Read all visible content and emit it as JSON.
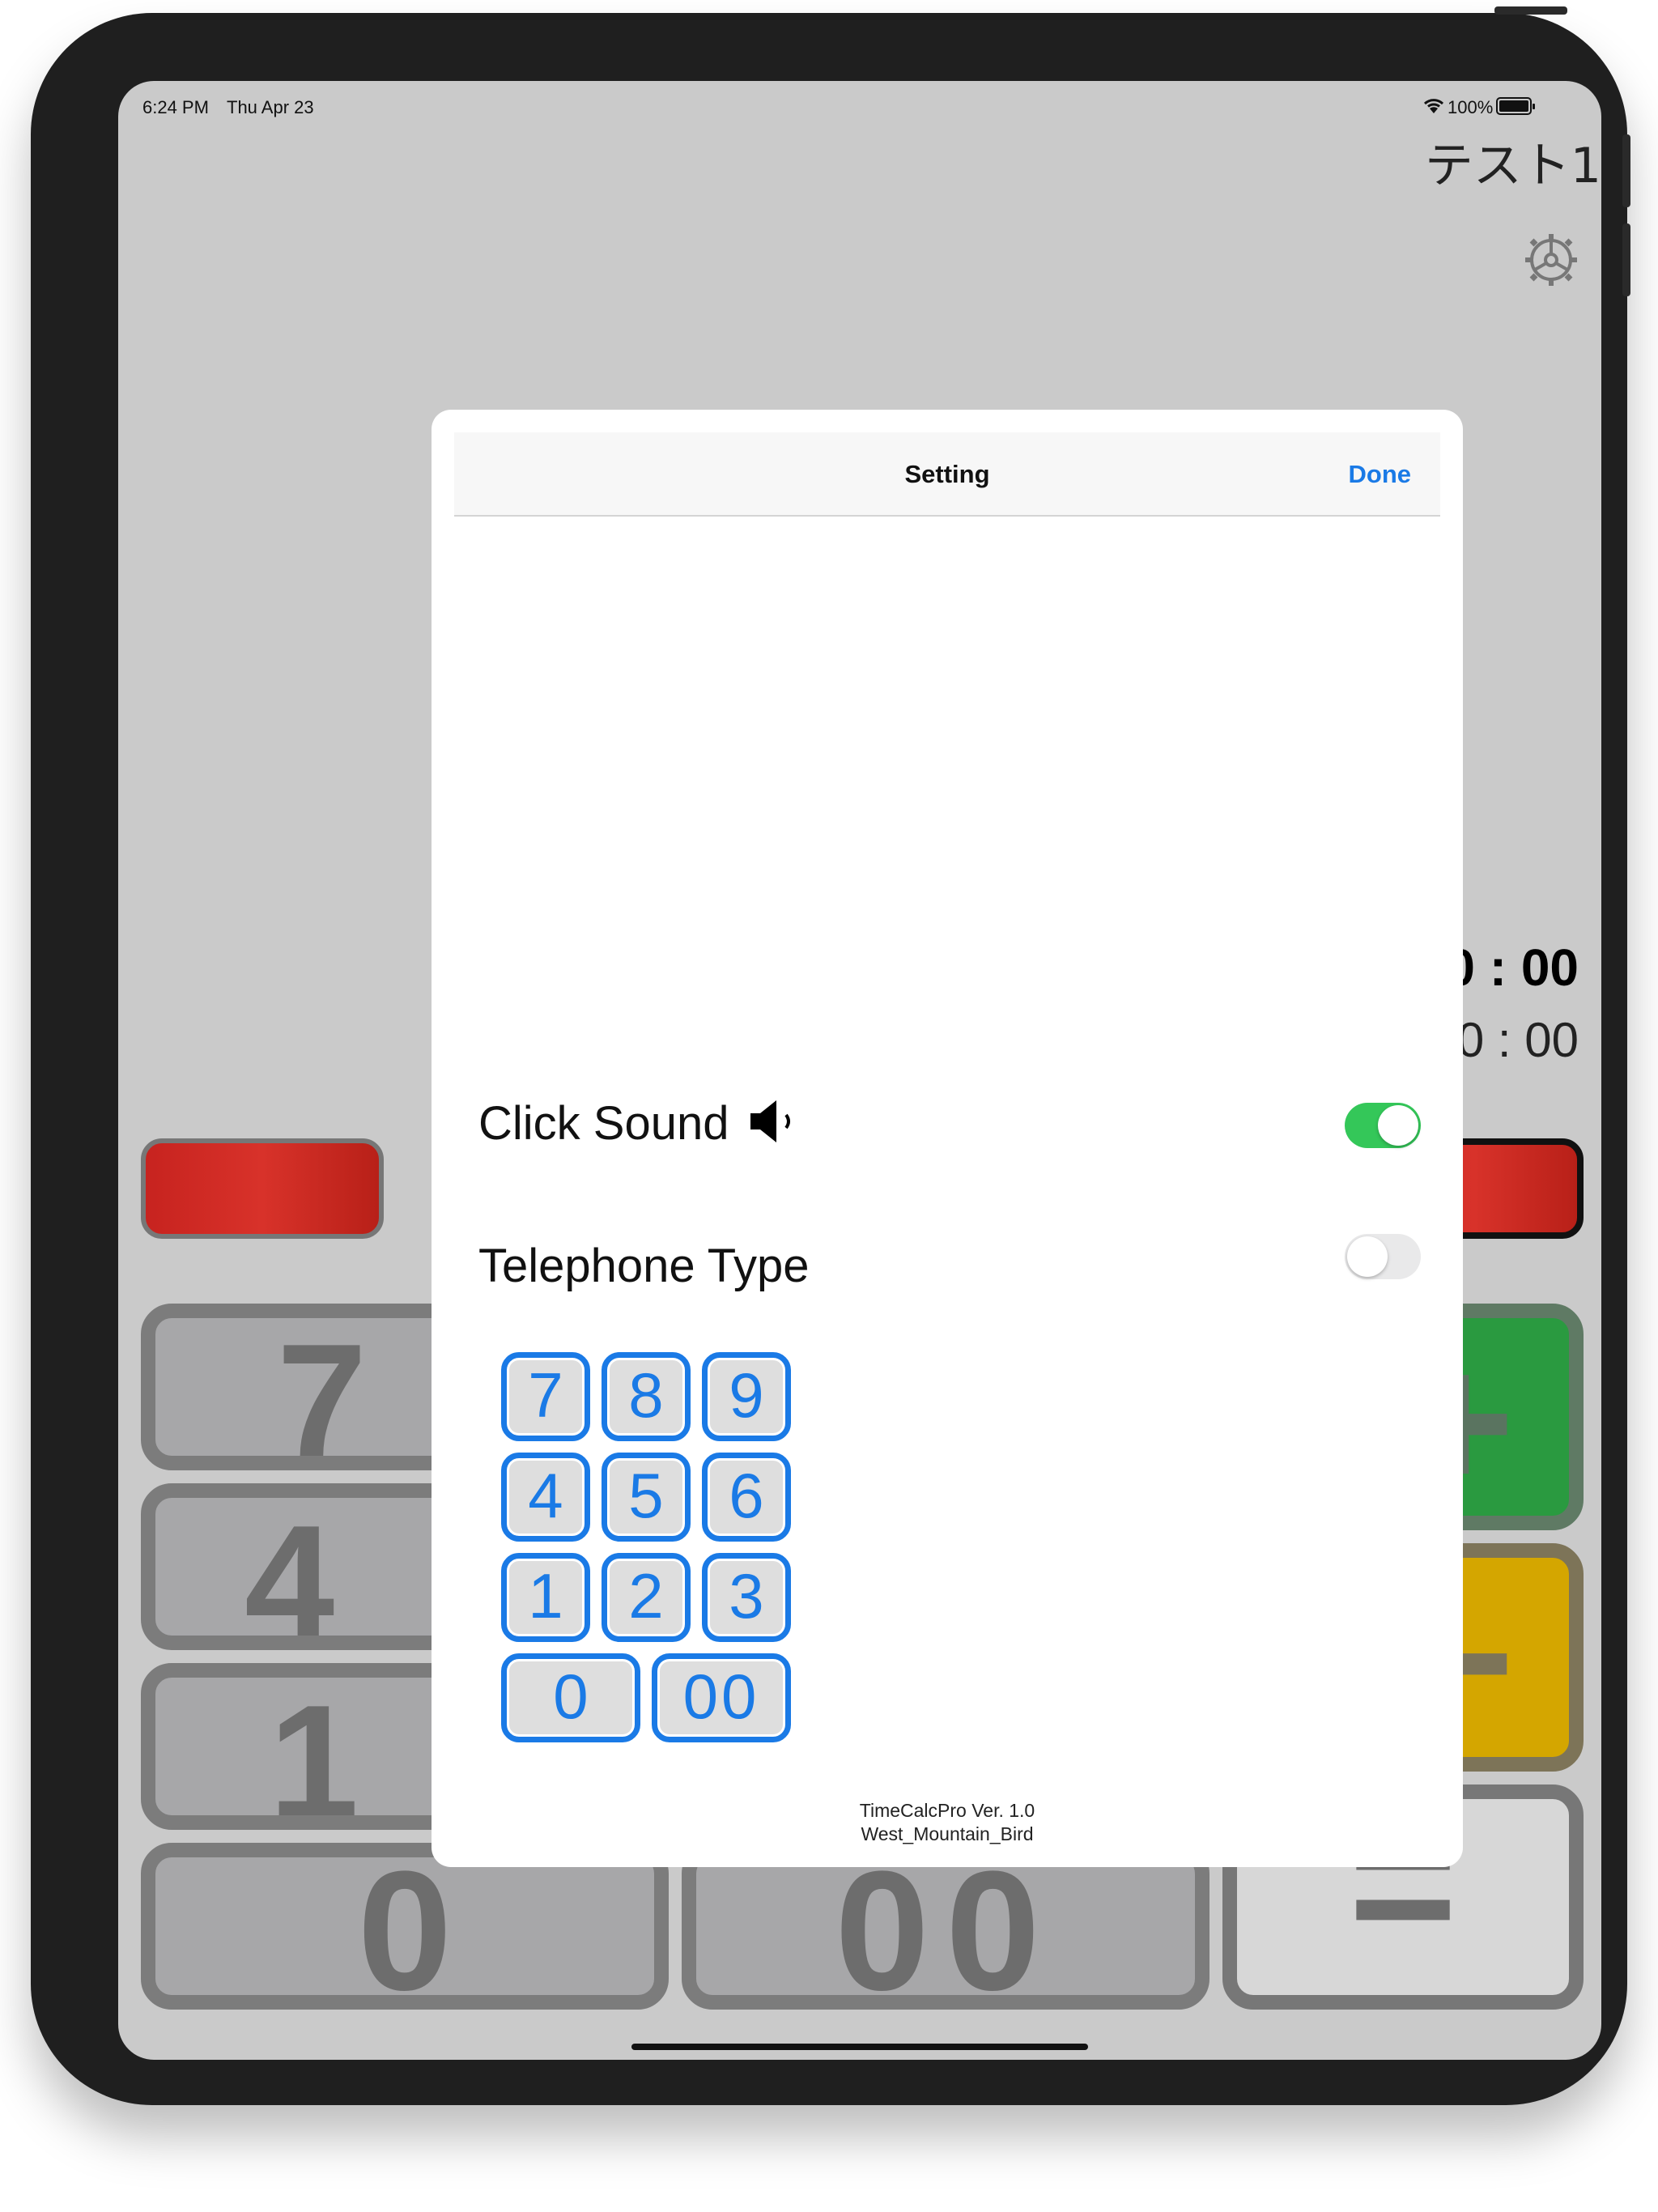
{
  "status_bar": {
    "time": "6:24 PM",
    "date": "Thu Apr 23",
    "battery": "100%",
    "wifi_icon": "wifi-icon",
    "battery_icon": "battery-icon"
  },
  "document_title": "テスト1",
  "settings_icon": "gear-icon",
  "display": {
    "total": "0 : 00",
    "entry": "+ 0 : 00"
  },
  "calculator_keys": {
    "seven": "7",
    "four": "4",
    "one": "1",
    "zero": "0",
    "double_zero": "00",
    "plus": "+",
    "minus": "−",
    "equals": "="
  },
  "modal": {
    "title": "Setting",
    "done_label": "Done",
    "click_sound": {
      "label": "Click Sound",
      "icon": "speaker-icon",
      "enabled": true
    },
    "telephone_type": {
      "label": "Telephone Type",
      "enabled": false
    },
    "keypad_preview": [
      "7",
      "8",
      "9",
      "4",
      "5",
      "6",
      "1",
      "2",
      "3",
      "0",
      "00"
    ],
    "app_version": "TimeCalcPro Ver. 1.0",
    "developer": "West_Mountain_Bird"
  },
  "colors": {
    "accent": "#1a7ae6",
    "toggle_on": "#34c759",
    "toggle_off": "#e9e9ea",
    "modal_bg": "#ffffff",
    "screen_bg": "#cacaca"
  }
}
